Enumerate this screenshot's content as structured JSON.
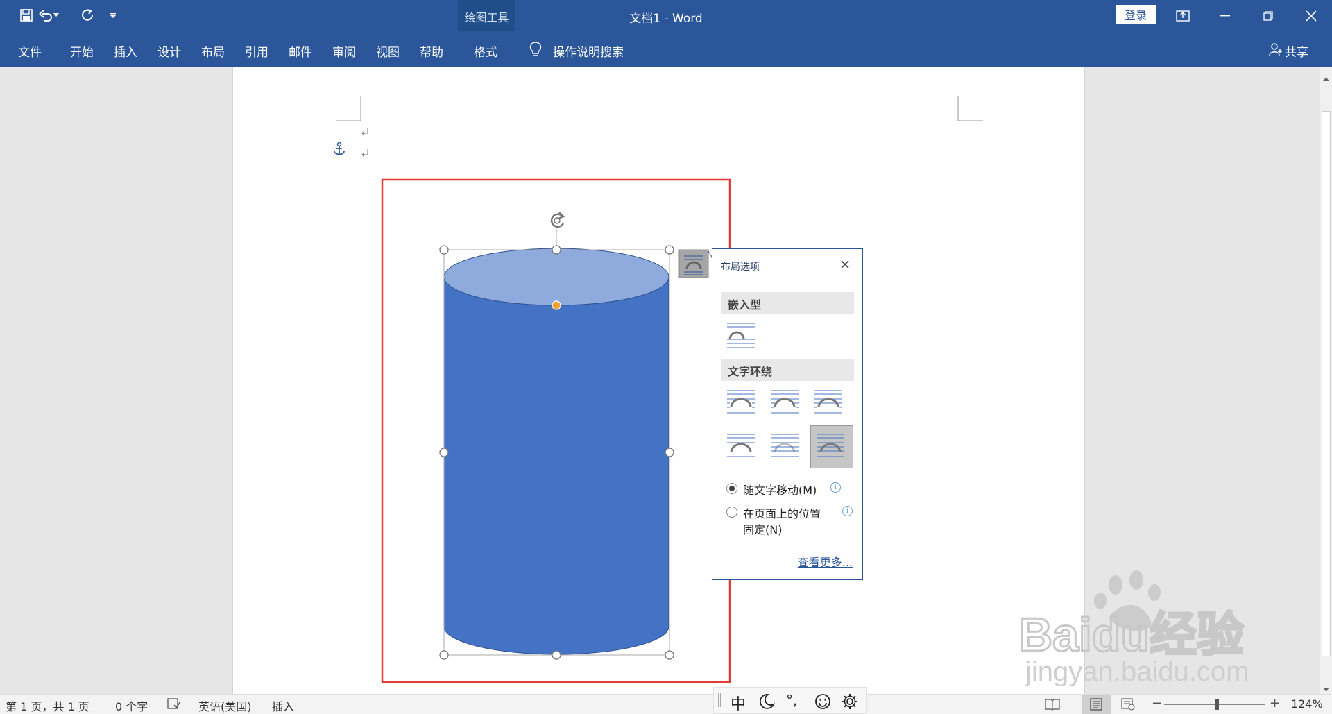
{
  "titlebar": {
    "document_title": "文档1  -  Word",
    "context_group": "绘图工具",
    "login_button": "登录"
  },
  "ribbon": {
    "tabs": [
      {
        "label": "文件"
      },
      {
        "label": "开始"
      },
      {
        "label": "插入"
      },
      {
        "label": "设计"
      },
      {
        "label": "布局"
      },
      {
        "label": "引用"
      },
      {
        "label": "邮件"
      },
      {
        "label": "审阅"
      },
      {
        "label": "视图"
      },
      {
        "label": "帮助"
      },
      {
        "label": "格式"
      }
    ],
    "search_placeholder": "操作说明搜索",
    "share_label": "共享"
  },
  "layout_options": {
    "title": "布局选项",
    "inline_section": "嵌入型",
    "wrap_section": "文字环绕",
    "option_move_with_text": "随文字移动(M)",
    "option_fixed_line1": "在页面上的位置",
    "option_fixed_line2": "固定(N)",
    "see_more": "查看更多..."
  },
  "statusbar": {
    "page_info": "第 1 页，共 1 页",
    "word_count": "0 个字",
    "language": "英语(美国)",
    "insert_mode": "插入",
    "zoom": "124%"
  },
  "ime_bar": {
    "mode": "中",
    "punct": "°,"
  },
  "watermark": {
    "brand": "Baidu经验",
    "url": "jingyan.baidu.com"
  },
  "colors": {
    "ribbon": "#2b579a",
    "shape_body": "#4472c4",
    "shape_top": "#8faadc",
    "highlight_box": "#e53935"
  }
}
